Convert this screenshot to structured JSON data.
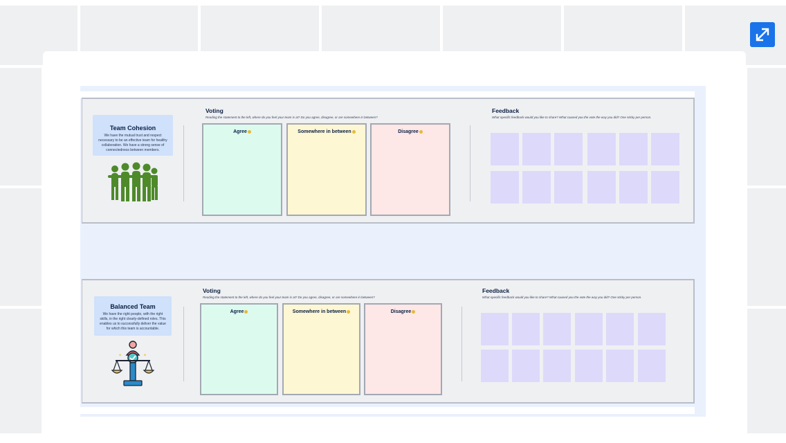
{
  "expand_button": {
    "icon": "expand-arrows-icon",
    "color": "#1a73e8"
  },
  "sections": [
    {
      "topic_title": "Team Cohesion",
      "topic_description": "We have the mutual trust and respect necessary to be an effective team for healthy collaboration. We have a strong sense of connectedness between members.",
      "illustration": "team-group-icon",
      "voting_title": "Voting",
      "voting_prompt": "Reading the statement to the left, where do you feel your team is at? Do you agree, disagree, or are somewhere in between?",
      "vote_options": [
        "Agree",
        "Somewhere in between",
        "Disagree"
      ],
      "feedback_title": "Feedback",
      "feedback_prompt": "What specific feedback would you like to share? What caused you the vote the way you did? One sticky per person."
    },
    {
      "topic_title": "Balanced Team",
      "topic_description": "We have the right people, with the right skills, in the right clearly-defined roles. This enables us to successfully deliver the value for which this team is accountable.",
      "illustration": "balance-scale-person-icon",
      "voting_title": "Voting",
      "voting_prompt": "Reading the statement to the left, where do you feel your team is at? Do you agree, disagree, or are somewhere in between?",
      "vote_options": [
        "Agree",
        "Somewhere in between",
        "Disagree"
      ],
      "feedback_title": "Feedback",
      "feedback_prompt": "What specific feedback would you like to share? What caused you the vote the way you did? One sticky per person."
    }
  ],
  "colors": {
    "agree": "#dcfbee",
    "between": "#fdf7d3",
    "disagree": "#fde7e7",
    "sticky": "#ddd9fb",
    "topic": "#cfe1fb"
  }
}
